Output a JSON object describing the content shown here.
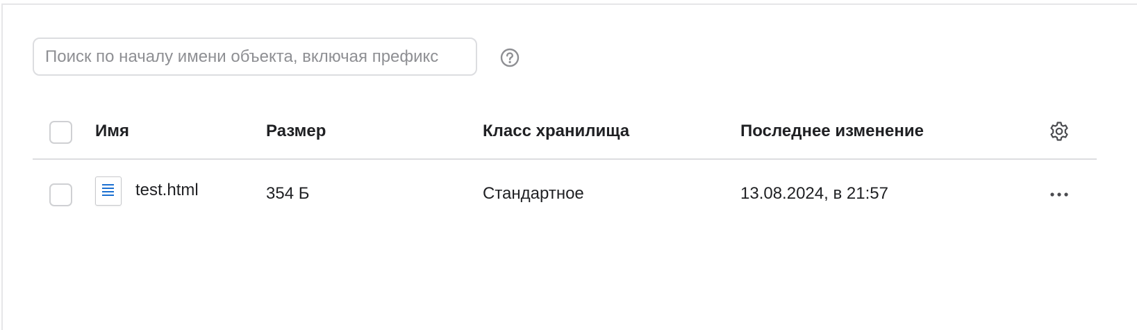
{
  "search": {
    "placeholder": "Поиск по началу имени объекта, включая префикс",
    "value": ""
  },
  "icons": {
    "help": "help-circle-icon",
    "settings": "gear-icon",
    "file": "document-icon",
    "more": "more-horizontal-icon"
  },
  "table": {
    "columns": {
      "name": "Имя",
      "size": "Размер",
      "storage_class": "Класс хранилища",
      "modified": "Последнее изменение"
    },
    "rows": [
      {
        "name": "test.html",
        "size": "354 Б",
        "storage_class": "Стандартное",
        "modified": "13.08.2024, в 21:57"
      }
    ]
  },
  "colors": {
    "border": "#dcdde0",
    "text": "#1f2023",
    "placeholder": "#8e8f93",
    "icon_gray": "#8e8f93",
    "file_icon_accent": "#1a6fd1"
  }
}
